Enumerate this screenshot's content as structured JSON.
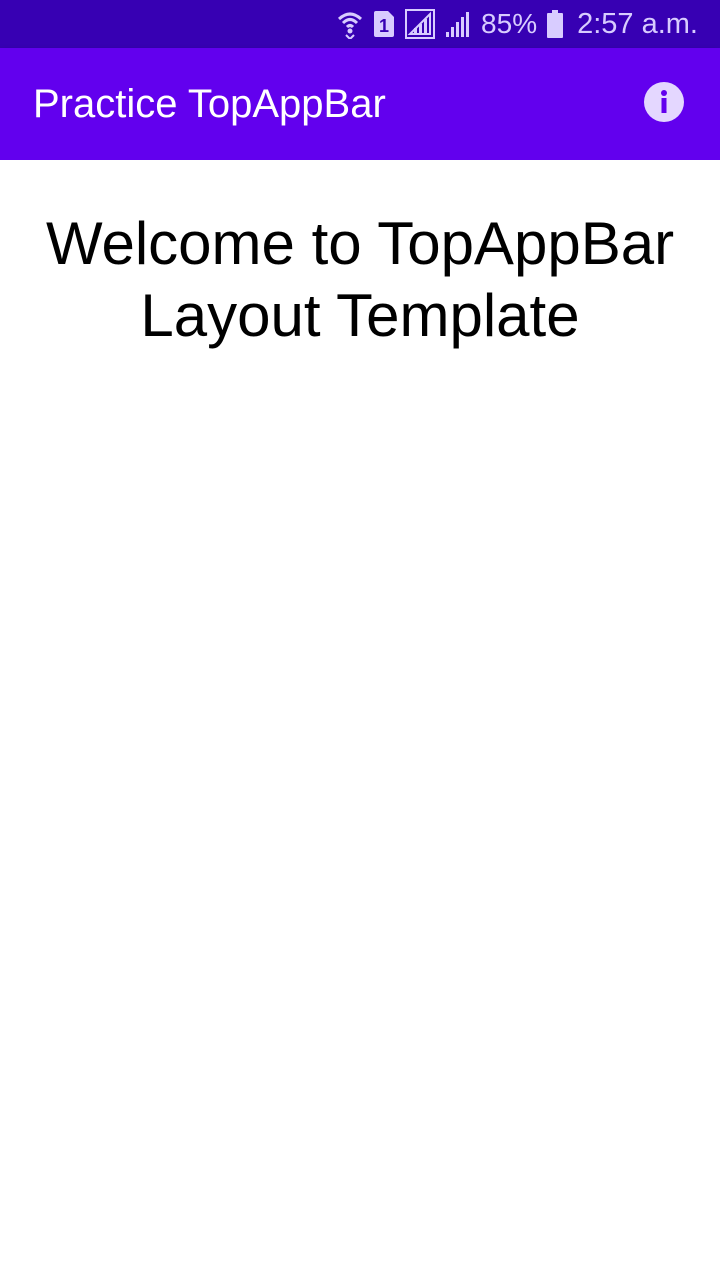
{
  "status_bar": {
    "sim_slot": "1",
    "battery_percent": "85%",
    "time": "2:57 a.m.",
    "icons": [
      "wifi-icon",
      "sim-icon",
      "signal-icon",
      "signal-icon",
      "battery-icon"
    ]
  },
  "app_bar": {
    "title": "Practice TopAppBar",
    "action_icon": "info-icon",
    "background": "#6200ee"
  },
  "content": {
    "welcome_text": "Welcome to TopAppBar Layout Template"
  },
  "colors": {
    "status_bar": "#3700b3",
    "primary": "#6200ee",
    "on_primary": "#ffffff",
    "icon_tint": "#d8ccff"
  }
}
